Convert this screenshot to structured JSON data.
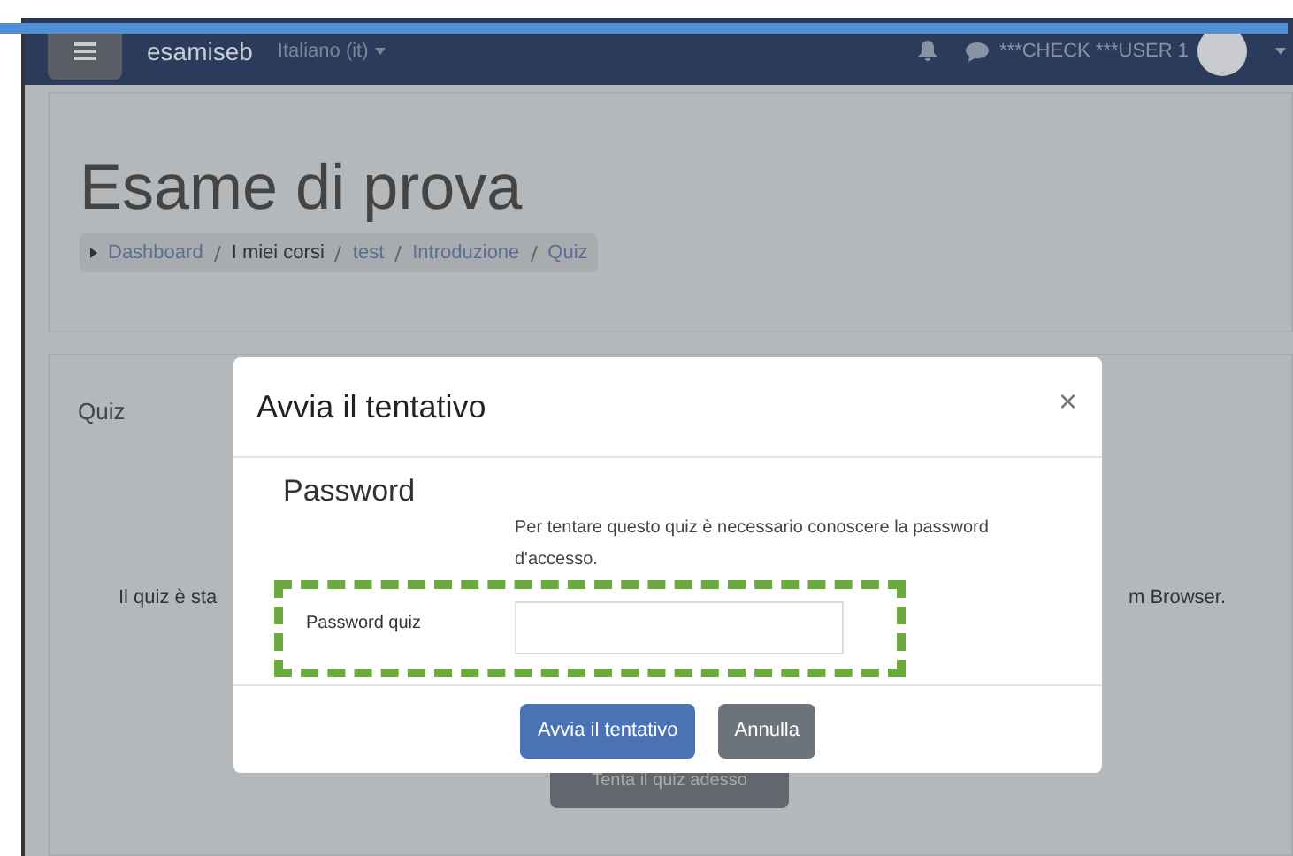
{
  "navbar": {
    "site_name": "esamiseb",
    "language": "Italiano (it)",
    "user": "***CHECK ***USER 1"
  },
  "header": {
    "title": "Esame di prova",
    "breadcrumb": [
      "Dashboard",
      "I miei corsi",
      "test",
      "Introduzione",
      "Quiz"
    ]
  },
  "quiz_card": {
    "title": "Quiz",
    "message_start": "Il quiz è sta",
    "message_end": "m Browser.",
    "button": "Tenta il quiz adesso"
  },
  "modal": {
    "title": "Avvia il tentativo",
    "close": "×",
    "section": "Password",
    "info": "Per tentare questo quiz è necessario conoscere la password d'accesso.",
    "field_label": "Password quiz",
    "buttons": [
      {
        "label": "Avvia il tentativo",
        "kind": "primary"
      },
      {
        "label": "Annulla",
        "kind": "secondary"
      }
    ]
  }
}
